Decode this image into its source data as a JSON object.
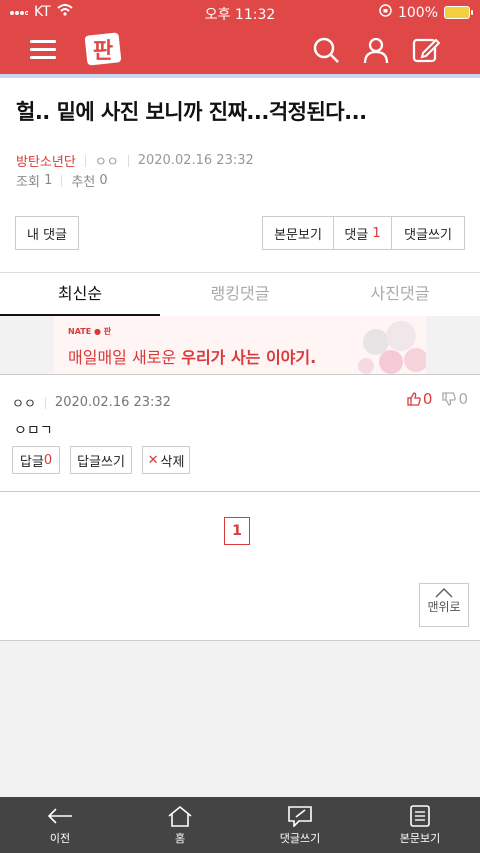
{
  "status": {
    "carrier": "KT",
    "time": "오후 11:32",
    "battery": "100%"
  },
  "header": {
    "logo_text": "판"
  },
  "post": {
    "title": "헐.. 밑에 사진 보니까 진짜...걱정된다...",
    "category": "방탄소년단",
    "author": "ㅇㅇ",
    "date": "2020.02.16 23:32",
    "views_label": "조회",
    "views": "1",
    "recommend_label": "추천",
    "recommend": "0"
  },
  "actions": {
    "my_comments": "내 댓글",
    "view_body": "본문보기",
    "comments_label": "댓글",
    "comments_count": "1",
    "write_comment": "댓글쓰기"
  },
  "tabs": [
    {
      "label": "최신순",
      "active": true
    },
    {
      "label": "랭킹댓글",
      "active": false
    },
    {
      "label": "사진댓글",
      "active": false
    }
  ],
  "ad": {
    "brand": "NATE ● 판",
    "text_prefix": "매일매일 새로운 ",
    "text_bold": "우리가 사는 이야기."
  },
  "comment": {
    "author": "ㅇㅇ",
    "date": "2020.02.16 23:32",
    "up": "0",
    "down": "0",
    "body": "ㅇㅁㄱ",
    "reply_label": "답글",
    "reply_count": "0",
    "write_reply": "답글쓰기",
    "delete": "삭제"
  },
  "pagination": {
    "current": "1"
  },
  "to_top": "맨위로",
  "bottom_nav": [
    {
      "label": "이전",
      "icon": "back-arrow-icon"
    },
    {
      "label": "홈",
      "icon": "home-icon"
    },
    {
      "label": "댓글쓰기",
      "icon": "comment-write-icon"
    },
    {
      "label": "본문보기",
      "icon": "document-icon"
    }
  ],
  "colors": {
    "brand_red": "#e04747",
    "accent_red": "#d93a3a",
    "bottom_bar": "#444444"
  }
}
